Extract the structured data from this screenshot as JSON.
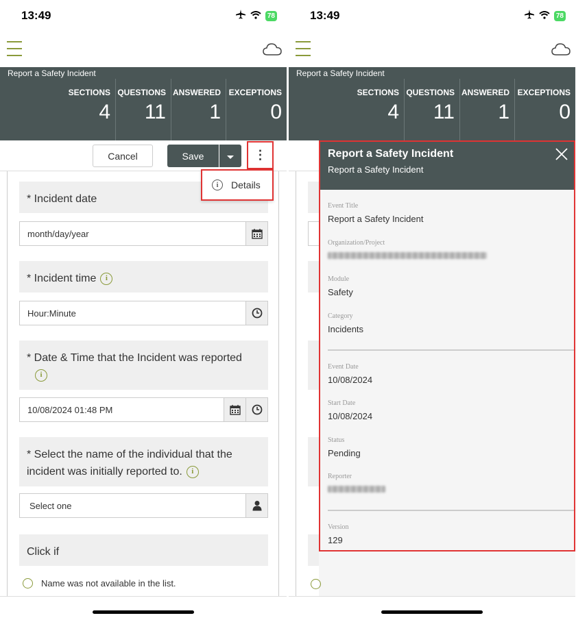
{
  "status": {
    "time": "13:49",
    "battery": "78"
  },
  "form": {
    "title": "Report a Safety Incident",
    "stats": [
      {
        "label": "SECTIONS",
        "value": "4"
      },
      {
        "label": "QUESTIONS",
        "value": "11"
      },
      {
        "label": "ANSWERED",
        "value": "1"
      },
      {
        "label": "EXCEPTIONS",
        "value": "0"
      }
    ],
    "toolbar": {
      "cancel": "Cancel",
      "save": "Save",
      "kebab": "⋮"
    },
    "menu": {
      "details": "Details"
    },
    "questions": {
      "incident_date": "* Incident date",
      "incident_date_placeholder": "month/day/year",
      "incident_time": "* Incident time",
      "incident_time_placeholder": "Hour:Minute",
      "reported_datetime": "* Date & Time that the Incident was reported",
      "reported_datetime_value": "10/08/2024 01:48 PM",
      "reported_to": "* Select the name of the individual that the incident was initially reported to.",
      "reported_to_value": "Select one",
      "click_if": "Click if",
      "not_available": "Name was not available in the list."
    }
  },
  "details_panel": {
    "title": "Report a Safety Incident",
    "subtitle": "Report a Safety Incident",
    "fields": {
      "event_title_label": "Event Title",
      "event_title": "Report a Safety Incident",
      "org_label": "Organization/Project",
      "module_label": "Module",
      "module": "Safety",
      "category_label": "Category",
      "category": "Incidents",
      "event_date_label": "Event Date",
      "event_date": "10/08/2024",
      "start_date_label": "Start Date",
      "start_date": "10/08/2024",
      "status_label": "Status",
      "status": "Pending",
      "reporter_label": "Reporter",
      "version_label": "Version",
      "version": "129"
    }
  },
  "colors": {
    "header": "#4a5656",
    "accent": "#8a9a3a",
    "highlight": "#e03333"
  }
}
